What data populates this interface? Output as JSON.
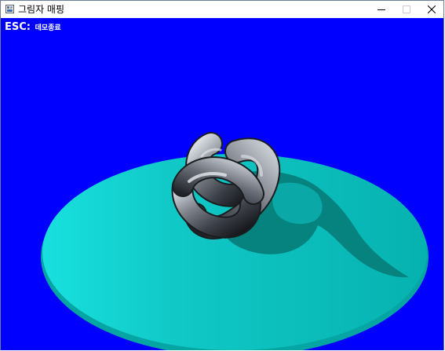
{
  "window": {
    "title": "그림자 매핑",
    "icon": "app-icon",
    "controls": {
      "minimize": "minimize-icon",
      "maximize": "maximize-icon",
      "close": "close-icon"
    }
  },
  "viewport": {
    "background_color": "#0000ff",
    "esc_key": "ESC:",
    "esc_desc": "데모종료"
  },
  "scene": {
    "platform_color": "#12c9c9",
    "platform_rim_color": "#05aaa8",
    "shadow_color": "#077c78",
    "object": "torus-knot"
  }
}
